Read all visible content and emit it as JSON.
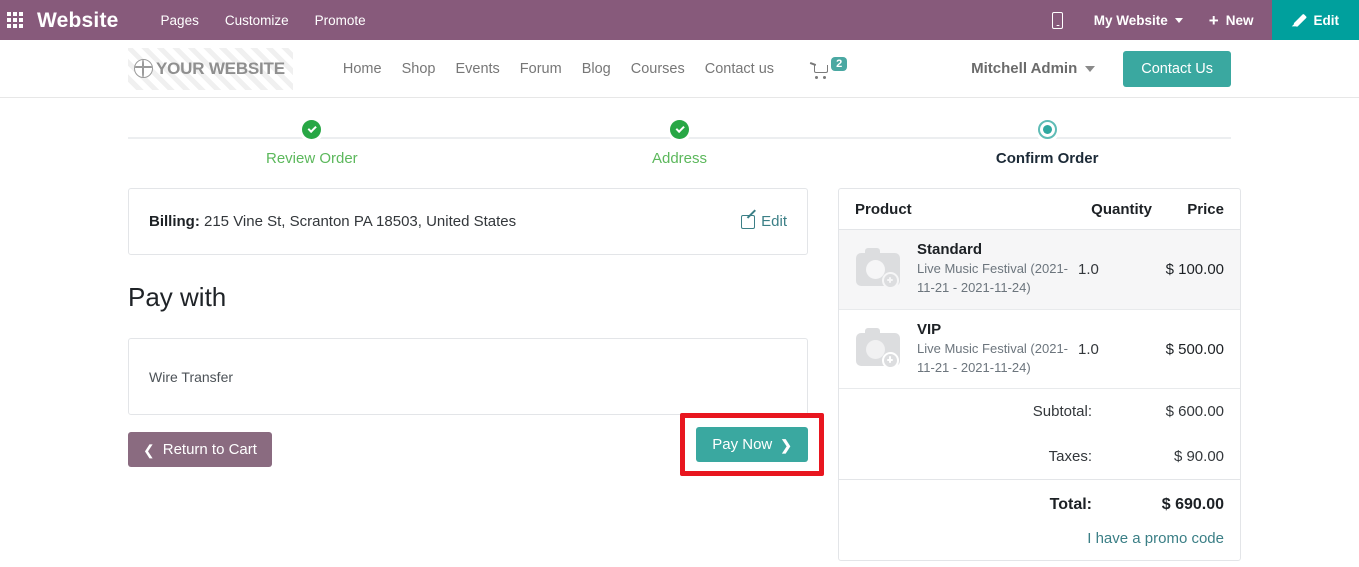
{
  "sysbar": {
    "apps_icon": "apps-grid-icon",
    "brand": "Website",
    "menus": [
      "Pages",
      "Customize",
      "Promote"
    ],
    "mobile_icon": "mobile-preview-icon",
    "website_selector": "My Website",
    "new_label": "New",
    "edit_label": "Edit",
    "bg_color": "#875a7b",
    "edit_color": "#00a09d"
  },
  "site_header": {
    "logo_text": "YOUR WEBSITE",
    "logo_icon": "globe-icon",
    "nav": [
      "Home",
      "Shop",
      "Events",
      "Forum",
      "Blog",
      "Courses",
      "Contact us"
    ],
    "cart_icon": "shopping-cart-icon",
    "cart_count": "2",
    "user_name": "Mitchell Admin",
    "contact_button": "Contact Us",
    "accent_color": "#3aa8a0"
  },
  "stepper": {
    "steps": [
      {
        "label": "Review Order",
        "state": "done"
      },
      {
        "label": "Address",
        "state": "done"
      },
      {
        "label": "Confirm Order",
        "state": "current"
      }
    ],
    "done_color": "#28a745",
    "current_color": "#2fa8a0"
  },
  "billing": {
    "label": "Billing:",
    "address": " 215 Vine St, Scranton PA 18503, United States",
    "edit_label": "Edit",
    "edit_icon": "edit-pencil-icon"
  },
  "payment": {
    "title": "Pay with",
    "options": [
      "Wire Transfer"
    ],
    "selected": "Wire Transfer"
  },
  "actions": {
    "return_label": "Return to Cart",
    "return_icon": "chevron-left-icon",
    "pay_label": "Pay Now",
    "pay_icon": "chevron-right-icon",
    "highlight_color": "#e8161f"
  },
  "summary": {
    "columns": {
      "product": "Product",
      "quantity": "Quantity",
      "price": "Price"
    },
    "rows": [
      {
        "name": "Standard",
        "description": "Live Music Festival (2021-11-21 - 2021-11-24)",
        "quantity": "1.0",
        "price": "$ 100.00",
        "thumb_icon": "image-placeholder-icon"
      },
      {
        "name": "VIP",
        "description": "Live Music Festival (2021-11-21 - 2021-11-24)",
        "quantity": "1.0",
        "price": "$ 500.00",
        "thumb_icon": "image-placeholder-icon"
      }
    ],
    "subtotal_label": "Subtotal:",
    "subtotal_value": "$ 600.00",
    "taxes_label": "Taxes:",
    "taxes_value": "$ 90.00",
    "total_label": "Total:",
    "total_value": "$ 690.00",
    "promo_label": "I have a promo code"
  }
}
